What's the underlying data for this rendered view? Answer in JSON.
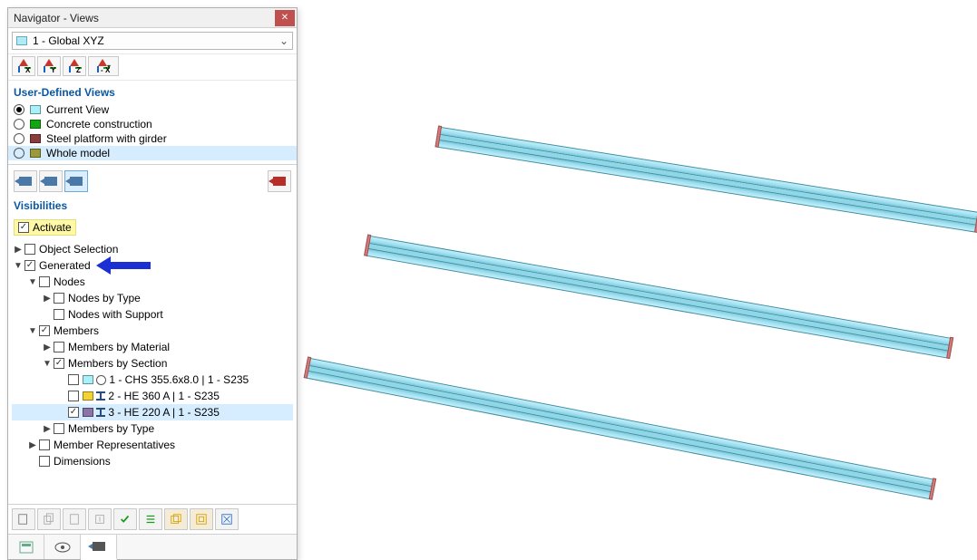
{
  "window": {
    "title": "Navigator - Views"
  },
  "combo": {
    "label": "1 - Global XYZ"
  },
  "axis": {
    "buttons": [
      "X",
      "Y",
      "Z",
      "X"
    ]
  },
  "udv": {
    "heading": "User-Defined Views",
    "items": [
      {
        "label": "Current View",
        "swatch": "c-cyan",
        "selected": true
      },
      {
        "label": "Concrete construction",
        "swatch": "c-green",
        "selected": false
      },
      {
        "label": "Steel platform with girder",
        "swatch": "c-darkred",
        "selected": false
      },
      {
        "label": "Whole model",
        "swatch": "c-olive",
        "selected": false,
        "row_selected": true
      }
    ]
  },
  "visibilities": {
    "heading": "Visibilities",
    "activate": "Activate"
  },
  "tree": {
    "object_selection": "Object Selection",
    "generated": "Generated",
    "nodes": "Nodes",
    "nodes_by_type": "Nodes by Type",
    "nodes_with_support": "Nodes with Support",
    "members": "Members",
    "members_by_material": "Members by Material",
    "members_by_section": "Members by Section",
    "sec1": "1 - CHS 355.6x8.0 | 1 - S235",
    "sec2": "2 - HE 360 A | 1 - S235",
    "sec3": "3 - HE 220 A | 1 - S235",
    "members_by_type": "Members by Type",
    "member_reps": "Member Representatives",
    "dimensions": "Dimensions"
  }
}
